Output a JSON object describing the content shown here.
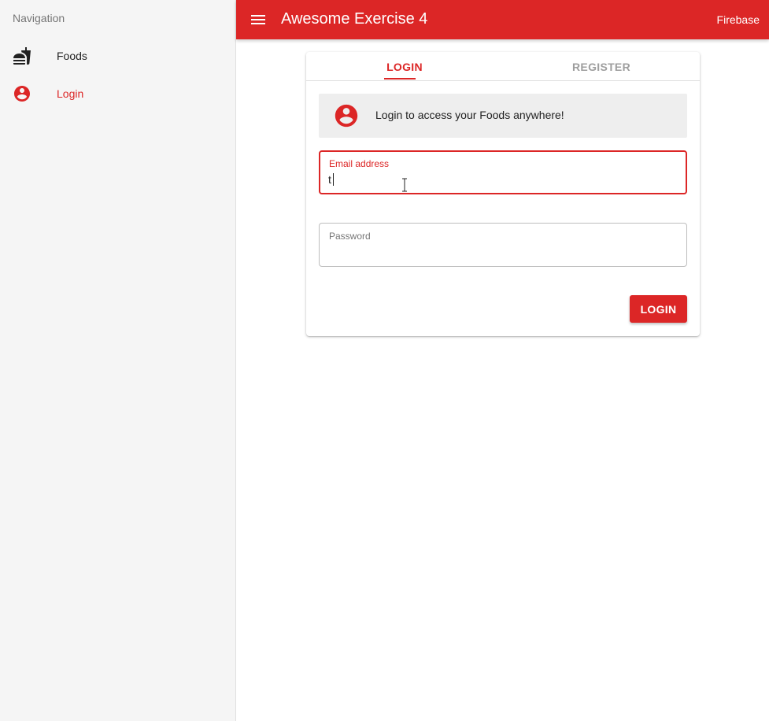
{
  "sidebar": {
    "header": "Navigation",
    "items": [
      {
        "label": "Foods",
        "icon": "fastfood-icon",
        "active": false
      },
      {
        "label": "Login",
        "icon": "account-circle-icon",
        "active": true
      }
    ]
  },
  "header": {
    "title": "Awesome Exercise 4",
    "right_link": "Firebase"
  },
  "tabs": [
    {
      "label": "LOGIN",
      "active": true
    },
    {
      "label": "REGISTER",
      "active": false
    }
  ],
  "banner": {
    "icon": "account-circle-icon",
    "text": "Login to access your Foods anywhere!"
  },
  "form": {
    "email": {
      "label": "Email address",
      "value": "t"
    },
    "password": {
      "label": "Password",
      "value": ""
    },
    "submit_label": "LOGIN"
  },
  "colors": {
    "primary": "#dc2626",
    "sidebar_bg": "#f5f5f5",
    "banner_bg": "#eeeeee",
    "inactive_tab": "#9e9e9e"
  }
}
